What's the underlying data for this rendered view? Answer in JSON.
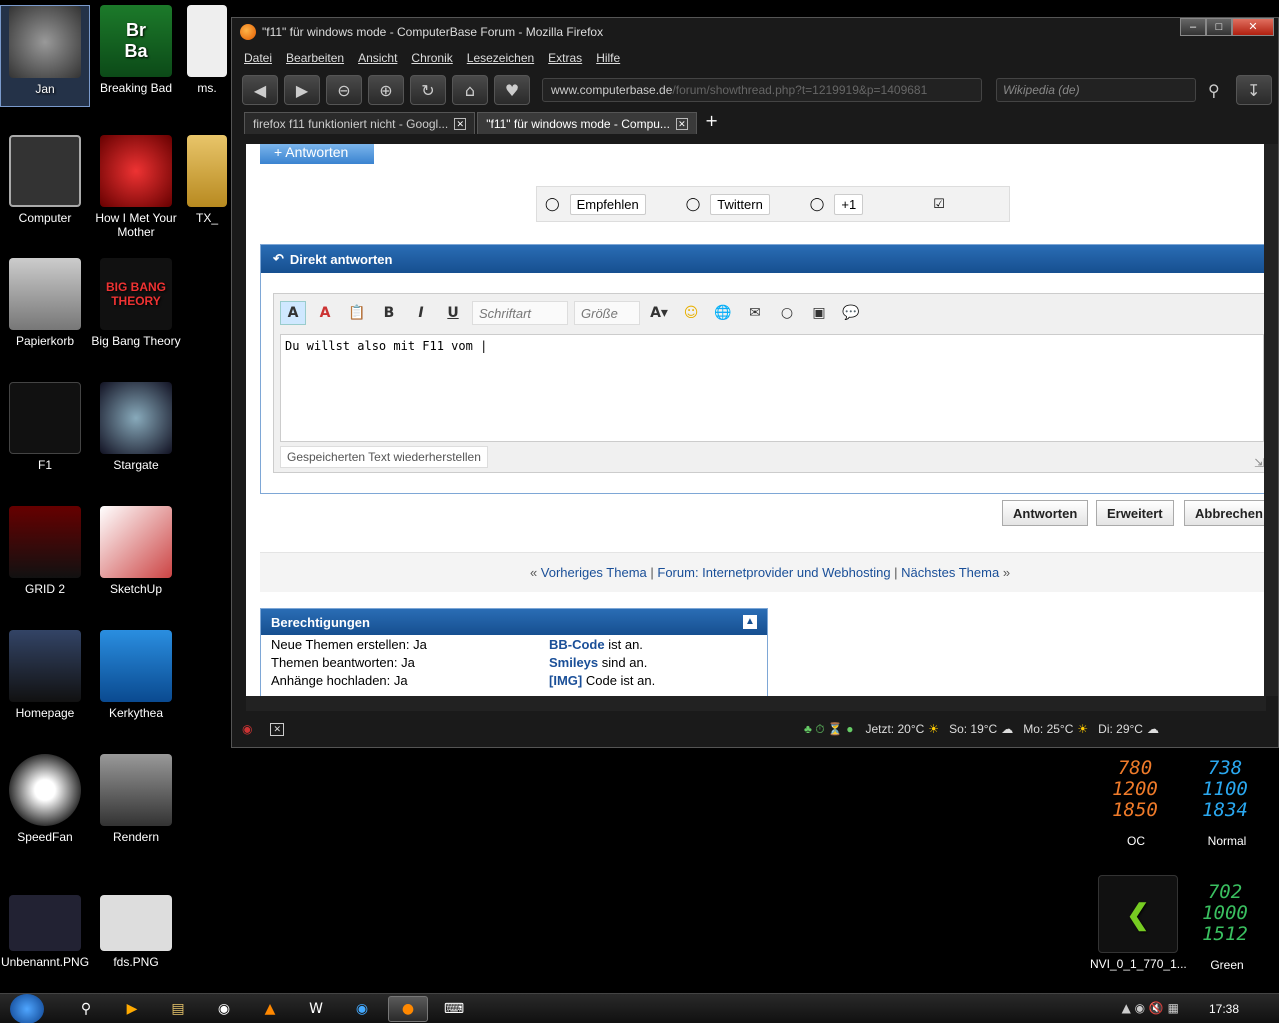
{
  "desktop": {
    "icons": [
      {
        "label": "Jan"
      },
      {
        "label": "Breaking Bad"
      },
      {
        "label": "ms."
      },
      {
        "label": "Computer"
      },
      {
        "label": "How I Met Your Mother"
      },
      {
        "label": "TX_"
      },
      {
        "label": "Papierkorb"
      },
      {
        "label": "Big Bang Theory"
      },
      {
        "label": "F1"
      },
      {
        "label": "Stargate"
      },
      {
        "label": "GRID 2"
      },
      {
        "label": "SketchUp"
      },
      {
        "label": "Homepage"
      },
      {
        "label": "Kerkythea"
      },
      {
        "label": "SpeedFan"
      },
      {
        "label": "Rendern"
      },
      {
        "label": "Unbenannt.PNG"
      },
      {
        "label": "fds.PNG"
      },
      {
        "label": "NVI_0_1_770_1..."
      }
    ],
    "icon_art": {
      "breaking_bad": "Br\nBa",
      "big_bang": "BIG BANG THEORY"
    },
    "gadgets": {
      "oc": {
        "values": [
          "780",
          "1200",
          "1850"
        ],
        "label": "OC",
        "color": "#f07b2a"
      },
      "normal": {
        "values": [
          "738",
          "1100",
          "1834"
        ],
        "label": "Normal",
        "color": "#2aa8f0"
      },
      "green": {
        "values": [
          "702",
          "1000",
          "1512"
        ],
        "label": "Green",
        "color": "#3ac060"
      }
    }
  },
  "firefox": {
    "title": "\"f11\" für windows mode - ComputerBase Forum - Mozilla Firefox",
    "menu": [
      "Datei",
      "Bearbeiten",
      "Ansicht",
      "Chronik",
      "Lesezeichen",
      "Extras",
      "Hilfe"
    ],
    "url_domain": "www.computerbase.de",
    "url_path": "/forum/showthread.php?t=1219919&p=1409681",
    "search_placeholder": "Wikipedia (de)",
    "tabs": [
      {
        "label": "firefox f11 funktioniert nicht - Googl..."
      },
      {
        "label": "\"f11\" für windows mode - Compu..."
      }
    ],
    "status": {
      "now": "Jetzt: 20°C",
      "sun": "So: 19°C",
      "mon": "Mo: 25°C",
      "tue": "Di: 29°C"
    }
  },
  "page": {
    "reply_top": "+ Antworten",
    "social": {
      "recommend": "Empfehlen",
      "tweet": "Twittern",
      "plus": "+1"
    },
    "quick_reply": {
      "title": "Direkt antworten",
      "font_placeholder": "Schriftart",
      "size_placeholder": "Größe",
      "text": "Du willst also mit F11 vom |",
      "restore": "Gespeicherten Text wiederherstellen"
    },
    "buttons": {
      "answer": "Antworten",
      "advanced": "Erweitert",
      "cancel": "Abbrechen"
    },
    "thread_nav": {
      "prev": "Vorheriges Thema",
      "forum": "Forum: Internetprovider und Webhosting",
      "next": "Nächstes Thema"
    },
    "rights": {
      "title": "Berechtigungen",
      "rows": [
        {
          "left": "Neue Themen erstellen: Ja",
          "bold": "BB-Code",
          "right": "ist an."
        },
        {
          "left": "Themen beantworten: Ja",
          "bold": "Smileys",
          "right": "sind an."
        },
        {
          "left": "Anhänge hochladen: Ja",
          "bold": "[IMG]",
          "right": "Code ist an."
        }
      ]
    }
  },
  "taskbar": {
    "clock": "17:38"
  }
}
